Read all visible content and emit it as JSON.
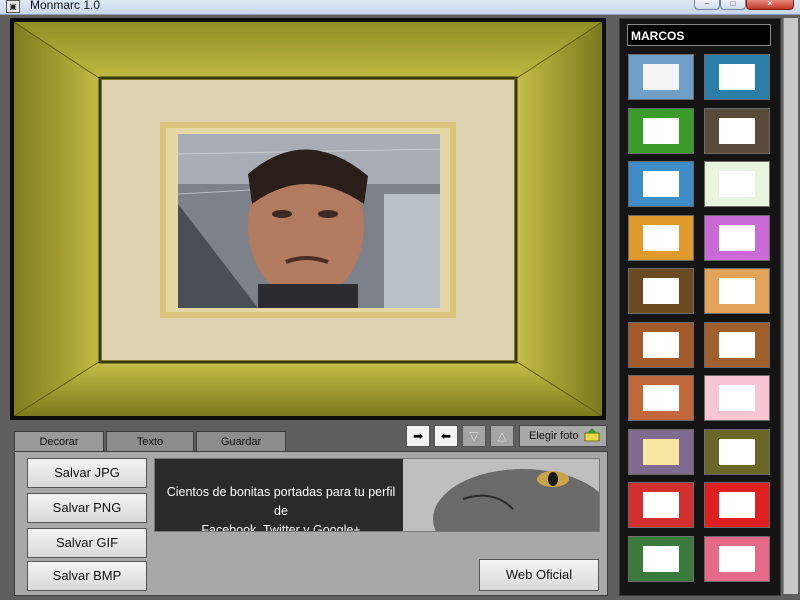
{
  "window": {
    "title": "Monmarc 1.0"
  },
  "tabs": [
    {
      "label": "Decorar"
    },
    {
      "label": "Texto"
    },
    {
      "label": "Guardar"
    }
  ],
  "toolbar": {
    "icons": [
      "arrow-right-icon",
      "arrow-left-icon",
      "triangle-down-icon",
      "triangle-up-icon"
    ],
    "choose_photo_label": "Elegir foto"
  },
  "save_buttons": [
    {
      "label": "Salvar JPG"
    },
    {
      "label": "Salvar PNG"
    },
    {
      "label": "Salvar GIF"
    },
    {
      "label": "Salvar BMP"
    }
  ],
  "banner": {
    "line1": "Cientos de bonitas portadas para tu perfil de",
    "line2": "Facebook, Twitter y Google+"
  },
  "web_button_label": "Web Oficial",
  "sidebar": {
    "title": "MARCOS",
    "frames": [
      {
        "name": "frame-oval-wreath",
        "bg": "#6fa0c8",
        "inner": "#f5f5f5"
      },
      {
        "name": "frame-blue-border",
        "bg": "#2a7ea8",
        "inner": "#ffffff"
      },
      {
        "name": "frame-green-cactus",
        "bg": "#3a9a2a",
        "inner": "#ffffff"
      },
      {
        "name": "frame-dark-wood",
        "bg": "#5a4a3a",
        "inner": "#ffffff"
      },
      {
        "name": "frame-blue-light",
        "bg": "#3f8cc6",
        "inner": "#ffffff"
      },
      {
        "name": "frame-green-leaves",
        "bg": "#e9f4df",
        "inner": "#ffffff"
      },
      {
        "name": "frame-orange",
        "bg": "#e09a2c",
        "inner": "#ffffff"
      },
      {
        "name": "frame-love",
        "bg": "#c96ad6",
        "inner": "#ffffff"
      },
      {
        "name": "frame-gold-ornate",
        "bg": "#6a4a1e",
        "inner": "#ffffff"
      },
      {
        "name": "frame-autumn",
        "bg": "#e3a45a",
        "inner": "#ffffff"
      },
      {
        "name": "frame-rust-wood",
        "bg": "#a25a2a",
        "inner": "#ffffff"
      },
      {
        "name": "frame-brown-wood",
        "bg": "#a0602e",
        "inner": "#ffffff"
      },
      {
        "name": "frame-vintage-paper",
        "bg": "#c0683a",
        "inner": "#ffffff"
      },
      {
        "name": "frame-hearts",
        "bg": "#f7c6d2",
        "inner": "#ffffff"
      },
      {
        "name": "frame-note-paper",
        "bg": "#806a90",
        "inner": "#f7e6a0"
      },
      {
        "name": "frame-olive-gold",
        "bg": "#6a6628",
        "inner": "#ffffff"
      },
      {
        "name": "frame-red-floral",
        "bg": "#d42f2f",
        "inner": "#ffffff"
      },
      {
        "name": "frame-danger-sign",
        "bg": "#e02020",
        "inner": "#ffffff"
      },
      {
        "name": "frame-colorful",
        "bg": "#3a7a3a",
        "inner": "#ffffff"
      },
      {
        "name": "frame-roses",
        "bg": "#e86a8a",
        "inner": "#ffffff"
      }
    ]
  }
}
